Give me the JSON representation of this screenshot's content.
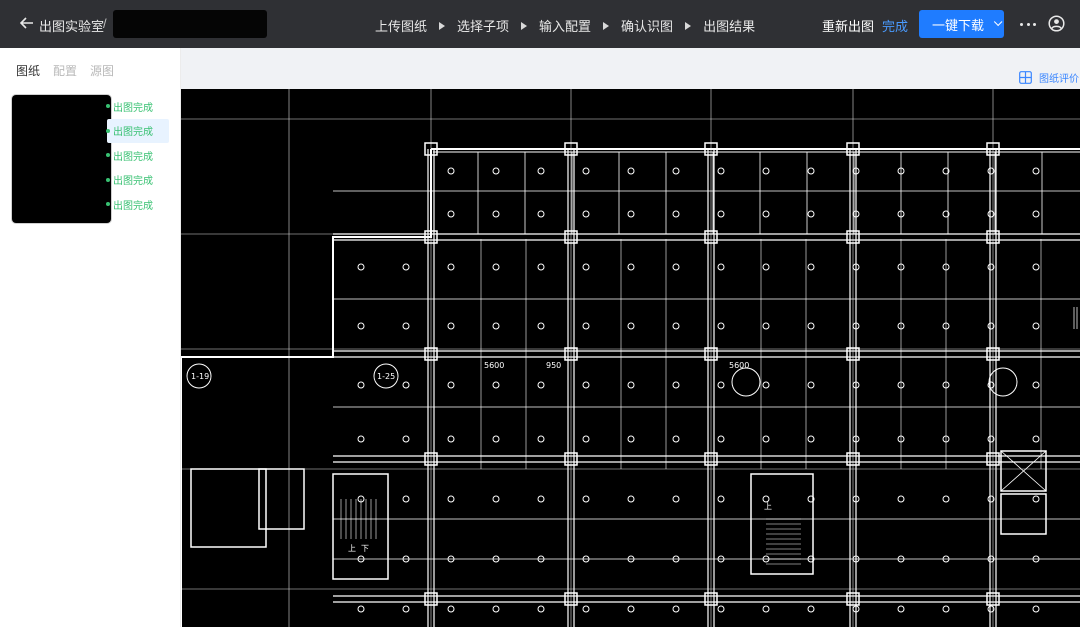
{
  "header": {
    "back_icon": "arrow-left-icon",
    "breadcrumb_root": "出图实验室",
    "breadcrumb_sep": "/",
    "steps": [
      {
        "label": "上传图纸"
      },
      {
        "label": "选择子项"
      },
      {
        "label": "输入配置"
      },
      {
        "label": "确认识图"
      },
      {
        "label": "出图结果"
      }
    ],
    "regenerate_label": "重新出图",
    "done_label": "完成",
    "download_label": "一键下载",
    "more_icon": "more-horizontal-icon",
    "user_icon": "user-circle-icon"
  },
  "sidebar": {
    "tabs": [
      {
        "label": "图纸",
        "active": true
      },
      {
        "label": "配置",
        "active": false
      },
      {
        "label": "源图",
        "active": false
      }
    ],
    "status_items": [
      {
        "label": "出图完成",
        "selected": false
      },
      {
        "label": "出图完成",
        "selected": true
      },
      {
        "label": "出图完成",
        "selected": false
      },
      {
        "label": "出图完成",
        "selected": false
      },
      {
        "label": "出图完成",
        "selected": false
      }
    ]
  },
  "toolbar": {
    "evaluate_label": "图纸评价",
    "evaluate_icon": "layout-grid-icon"
  },
  "drawing": {
    "labels": [
      "1-19",
      "1-25",
      "5600",
      "950",
      "5600",
      "上",
      "下",
      "上"
    ]
  },
  "colors": {
    "topbar_bg": "#2f3034",
    "accent": "#1f7cff",
    "done_text": "#4a9bff",
    "status_green": "#38c172",
    "canvas_bg": "#000000",
    "line_color": "#ffffff"
  }
}
